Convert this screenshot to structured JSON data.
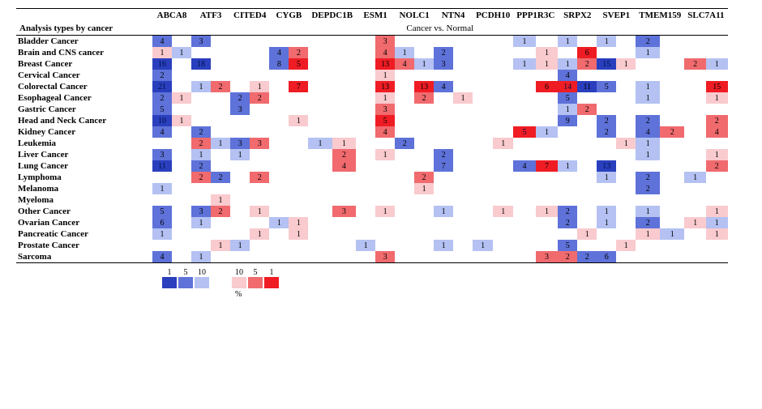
{
  "header_section": "Analysis types by cancer",
  "subtitle": "Cancer vs. Normal",
  "columns": [
    "ABCA8",
    "ATF3",
    "CITED4",
    "CYGB",
    "DEPDC1B",
    "ESM1",
    "NOLC1",
    "NTN4",
    "PCDH10",
    "PPP1R3C",
    "SRPX2",
    "SVEP1",
    "TMEM159",
    "SLC7A11"
  ],
  "legend": {
    "blue_labels": [
      "1",
      "5",
      "10"
    ],
    "red_labels": [
      "10",
      "5",
      "1"
    ],
    "percent": "%"
  },
  "palette": {
    "b1": "#2a3fbe",
    "b2": "#5e72d9",
    "b3": "#b4c1f2",
    "r1": "#ef1c24",
    "r2": "#f06a6e",
    "r3": "#f9cace"
  },
  "chart_data": {
    "type": "heatmap",
    "title": "Cancer vs. Normal",
    "xlabel": "",
    "ylabel": "",
    "note": "Two-sided counts; left cell = blue intensity, right cell = red intensity; values shown are counts displayed in cells; intensity keyed to legend 1/5/10 %.",
    "categories_x": [
      "ABCA8",
      "ATF3",
      "CITED4",
      "CYGB",
      "DEPDC1B",
      "ESM1",
      "NOLC1",
      "NTN4",
      "PCDH10",
      "PPP1R3C",
      "SRPX2",
      "SVEP1",
      "TMEM159",
      "SLC7A11"
    ],
    "categories_y": [
      "Bladder Cancer",
      "Brain and CNS cancer",
      "Breast Cancer",
      "Cervical Cancer",
      "Colorectal Cancer",
      "Esophageal Cancer",
      "Gastric Cancer",
      "Head and Neck Cancer",
      "Kidney Cancer",
      "Leukemia",
      "Liver Cancer",
      "Lung Cancer",
      "Lymphoma",
      "Melanoma",
      "Myeloma",
      "Other Cancer",
      "Ovarian Cancer",
      "Pancreatic Cancer",
      "Prostate Cancer",
      "Sarcoma"
    ],
    "cells": [
      {
        "row": "Bladder Cancer",
        "cells": {
          "ABCA8": {
            "b": 4
          },
          "ATF3": {
            "b": 3
          },
          "ESM1": {
            "r": 3
          },
          "PPP1R3C": {
            "b": 1
          },
          "SRPX2": {
            "b": 1
          },
          "SVEP1": {
            "b": 1
          },
          "TMEM159": {
            "b": 2
          }
        }
      },
      {
        "row": "Brain and CNS cancer",
        "cells": {
          "ABCA8": {
            "b": 1,
            "r": 1,
            "rleft": true
          },
          "CYGB": {
            "b": 4,
            "r": 2
          },
          "ESM1": {
            "r": 4
          },
          "NOLC1": {
            "b": 1
          },
          "NTN4": {
            "b": 2
          },
          "PPP1R3C": {
            "r": 1
          },
          "SRPX2": {
            "r": 6
          },
          "TMEM159": {
            "b": 1
          }
        }
      },
      {
        "row": "Breast Cancer",
        "cells": {
          "ABCA8": {
            "b": 16
          },
          "ATF3": {
            "b": 18
          },
          "CYGB": {
            "b": 8,
            "r": 5
          },
          "ESM1": {
            "r": 13
          },
          "NOLC1": {
            "b": 1,
            "r": 4,
            "rleft": true
          },
          "NTN4": {
            "b": 3
          },
          "PPP1R3C": {
            "b": 1,
            "r": 1
          },
          "SRPX2": {
            "b": 1,
            "r": 2
          },
          "SVEP1": {
            "b": 15,
            "r": 1,
            "rleft": false
          },
          "SLC7A11": {
            "b": 1,
            "r": 2,
            "rleft": true,
            "bswap": true
          }
        }
      },
      {
        "row": "Cervical Cancer",
        "cells": {
          "ABCA8": {
            "b": 2
          },
          "ESM1": {
            "r": 1
          },
          "SRPX2": {
            "b": 4
          }
        }
      },
      {
        "row": "Colorectal Cancer",
        "cells": {
          "ABCA8": {
            "b": 21
          },
          "ATF3": {
            "b": 1,
            "r": 2
          },
          "CITED4": {
            "r": 1
          },
          "CYGB": {
            "r": 7
          },
          "ESM1": {
            "r": 13
          },
          "NOLC1": {
            "r": 13
          },
          "NTN4": {
            "b": 4
          },
          "PPP1R3C": {
            "r": 6
          },
          "SRPX2": {
            "b": 11,
            "r": 14,
            "rleft": true
          },
          "SVEP1": {
            "b": 5
          },
          "TMEM159": {
            "b": 1
          },
          "SLC7A11": {
            "r": 15
          }
        }
      },
      {
        "row": "Esophageal Cancer",
        "cells": {
          "ABCA8": {
            "b": 2,
            "r": 1
          },
          "CITED4": {
            "b": 2,
            "r": 2
          },
          "ESM1": {
            "r": 1
          },
          "NOLC1": {
            "r": 2
          },
          "NTN4": {
            "r": 1
          },
          "SRPX2": {
            "b": 5
          },
          "TMEM159": {
            "b": 1
          },
          "SLC7A11": {
            "r": 1
          }
        }
      },
      {
        "row": "Gastric Cancer",
        "cells": {
          "ABCA8": {
            "b": 5
          },
          "CITED4": {
            "b": 3
          },
          "ESM1": {
            "r": 3
          },
          "SRPX2": {
            "b": 1,
            "r": 2
          }
        }
      },
      {
        "row": "Head and Neck Cancer",
        "cells": {
          "ABCA8": {
            "b": 10,
            "r": 1
          },
          "CYGB": {
            "r": 1
          },
          "ESM1": {
            "r": 5
          },
          "SRPX2": {
            "b": 9
          },
          "SVEP1": {
            "b": 2
          },
          "TMEM159": {
            "b": 2
          },
          "SLC7A11": {
            "r": 2
          }
        }
      },
      {
        "row": "Kidney Cancer",
        "cells": {
          "ABCA8": {
            "b": 4
          },
          "ATF3": {
            "b": 2
          },
          "ESM1": {
            "r": 4
          },
          "PPP1R3C": {
            "b": 1,
            "r": 5,
            "rleft": true
          },
          "SVEP1": {
            "b": 2
          },
          "TMEM159": {
            "b": 4,
            "r": 2
          },
          "SLC7A11": {
            "r": 4
          }
        }
      },
      {
        "row": "Leukemia",
        "cells": {
          "ATF3": {
            "b": 1,
            "r": 2,
            "rleft": true
          },
          "CITED4": {
            "b": 3,
            "r": 3
          },
          "DEPDC1B": {
            "b": 1,
            "r": 1
          },
          "NOLC1": {
            "b": 2
          },
          "PCDH10": {
            "r": 1
          },
          "SVEP1": {
            "r": 1
          },
          "TMEM159": {
            "b": 1
          }
        }
      },
      {
        "row": "Liver Cancer",
        "cells": {
          "ABCA8": {
            "b": 3
          },
          "ATF3": {
            "b": 1
          },
          "CITED4": {
            "b": 1
          },
          "DEPDC1B": {
            "r": 2
          },
          "ESM1": {
            "r": 1
          },
          "NTN4": {
            "b": 2
          },
          "TMEM159": {
            "b": 1
          },
          "SLC7A11": {
            "r": 1
          }
        }
      },
      {
        "row": "Lung Cancer",
        "cells": {
          "ABCA8": {
            "b": 11
          },
          "ATF3": {
            "b": 2
          },
          "DEPDC1B": {
            "r": 4
          },
          "NTN4": {
            "b": 7
          },
          "PPP1R3C": {
            "b": 4,
            "r": 7
          },
          "SRPX2": {
            "b": 1
          },
          "SVEP1": {
            "b": 13
          },
          "SLC7A11": {
            "r": 2
          }
        }
      },
      {
        "row": "Lymphoma",
        "cells": {
          "ATF3": {
            "b": 2,
            "r": 2,
            "rleft": true
          },
          "CITED4": {
            "r": 2
          },
          "NOLC1": {
            "r": 2
          },
          "SVEP1": {
            "b": 1
          },
          "TMEM159": {
            "b": 2
          },
          "SLC7A11": {
            "b": 1
          }
        }
      },
      {
        "row": "Melanoma",
        "cells": {
          "ABCA8": {
            "b": 1
          },
          "NOLC1": {
            "r": 1
          },
          "TMEM159": {
            "b": 2
          }
        }
      },
      {
        "row": "Myeloma",
        "cells": {
          "ATF3": {
            "r": 1
          }
        }
      },
      {
        "row": "Other Cancer",
        "cells": {
          "ABCA8": {
            "b": 5
          },
          "ATF3": {
            "b": 3,
            "r": 2
          },
          "CITED4": {
            "r": 1
          },
          "DEPDC1B": {
            "r": 3
          },
          "ESM1": {
            "r": 1
          },
          "NTN4": {
            "b": 1
          },
          "PCDH10": {
            "r": 1
          },
          "PPP1R3C": {
            "r": 1
          },
          "SRPX2": {
            "b": 2
          },
          "SVEP1": {
            "b": 1
          },
          "TMEM159": {
            "b": 1
          },
          "SLC7A11": {
            "r": 1
          }
        }
      },
      {
        "row": "Ovarian Cancer",
        "cells": {
          "ABCA8": {
            "b": 6
          },
          "ATF3": {
            "b": 1
          },
          "CYGB": {
            "b": 1,
            "r": 1,
            "rleft": false
          },
          "SRPX2": {
            "b": 2
          },
          "SVEP1": {
            "b": 1
          },
          "TMEM159": {
            "b": 2
          },
          "SLC7A11": {
            "b": 1,
            "r": 1,
            "bswap": true
          }
        }
      },
      {
        "row": "Pancreatic Cancer",
        "cells": {
          "ABCA8": {
            "b": 1
          },
          "CITED4": {
            "r": 1
          },
          "CYGB": {
            "r": 1
          },
          "SRPX2": {
            "r": 1
          },
          "TMEM159": {
            "b": 1,
            "r": 1,
            "rleft": true
          },
          "SLC7A11": {
            "r": 1
          }
        }
      },
      {
        "row": "Prostate Cancer",
        "cells": {
          "ATF3": {
            "r": 1
          },
          "CITED4": {
            "b": 1
          },
          "ESM1": {
            "b": 1
          },
          "NTN4": {
            "b": 1
          },
          "PCDH10": {
            "b": 1
          },
          "SRPX2": {
            "b": 5
          },
          "SVEP1": {
            "r": 1
          }
        }
      },
      {
        "row": "Sarcoma",
        "cells": {
          "ABCA8": {
            "b": 4
          },
          "ATF3": {
            "b": 1
          },
          "ESM1": {
            "r": 3
          },
          "PPP1R3C": {
            "r": 3
          },
          "SRPX2": {
            "b": 2,
            "r": 2,
            "rleft": true
          },
          "SVEP1": {
            "b": 6
          }
        }
      }
    ]
  }
}
